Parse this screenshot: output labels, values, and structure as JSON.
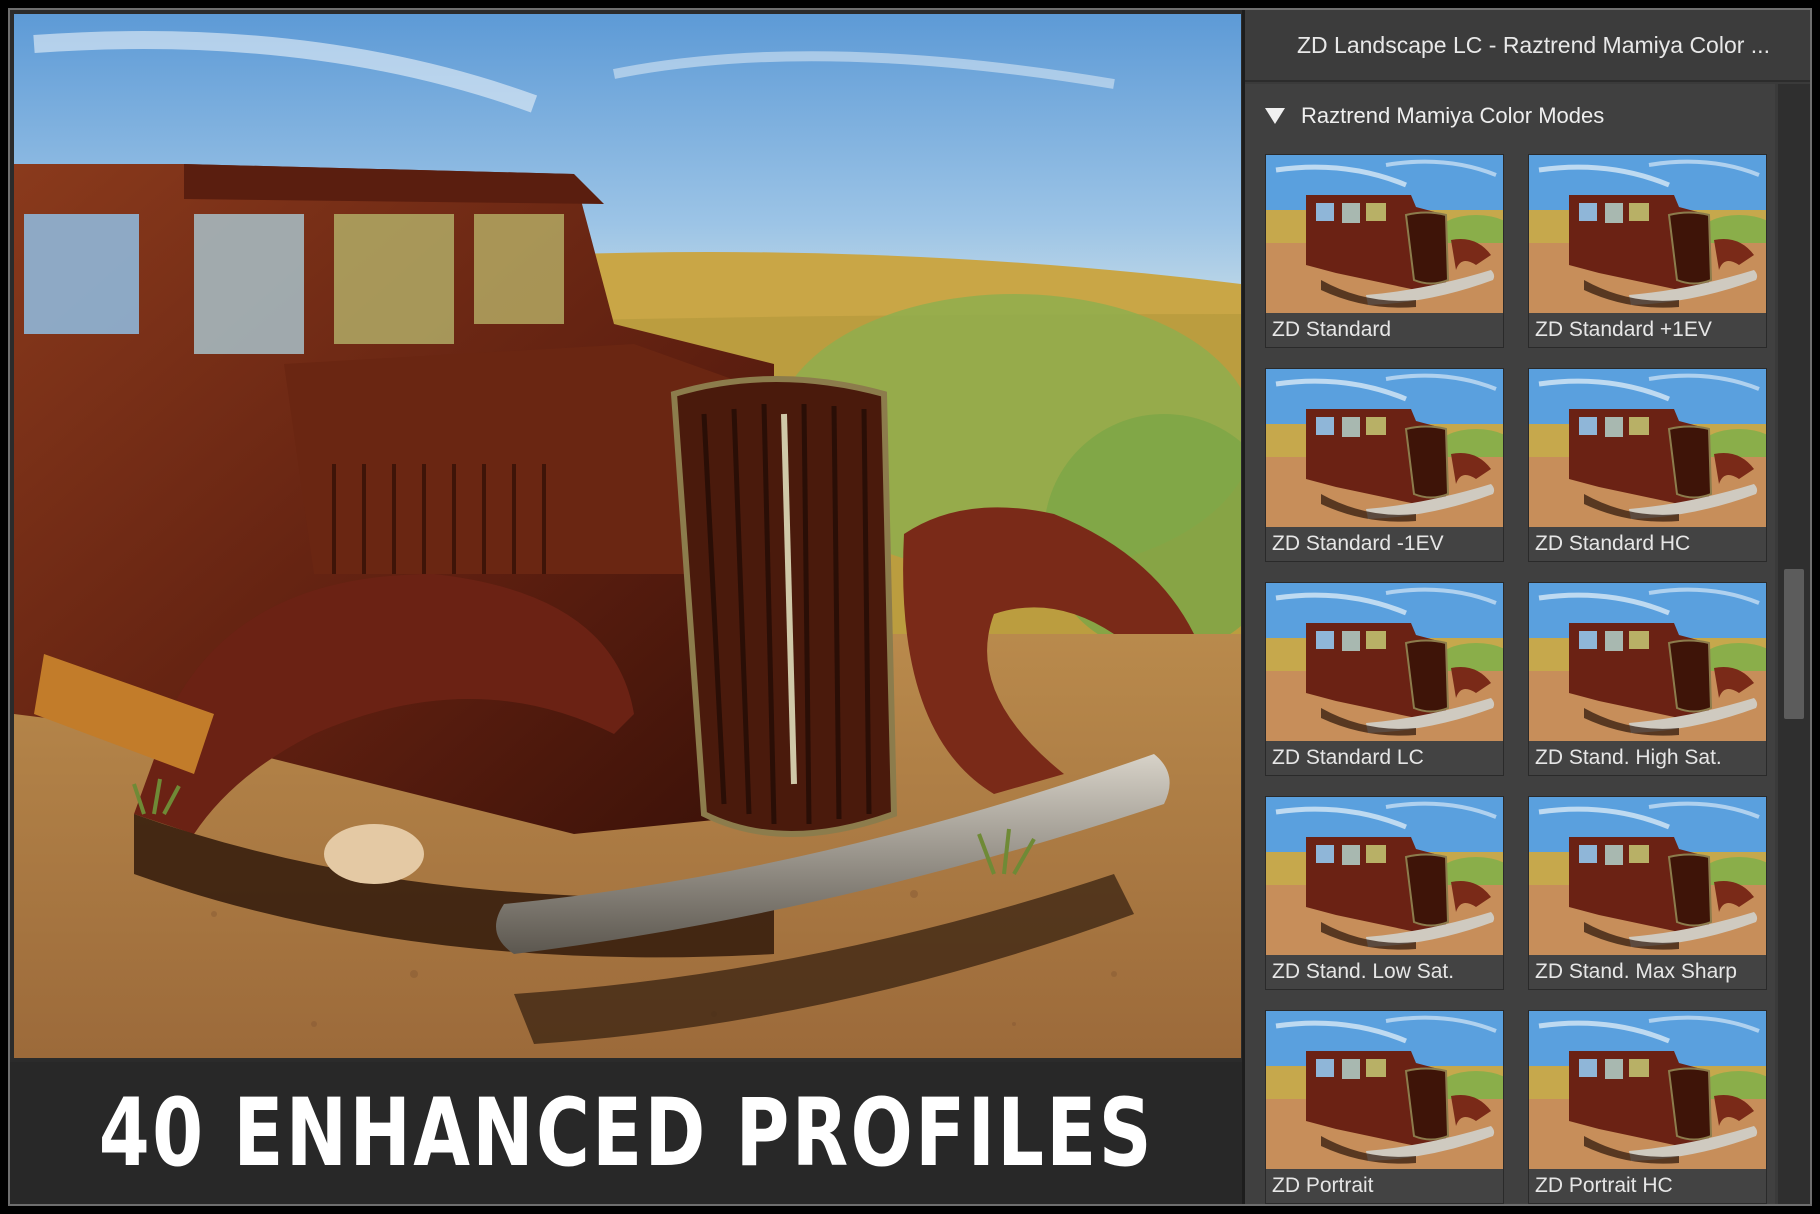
{
  "panel": {
    "title": "ZD Landscape LC - Raztrend Mamiya Color ...",
    "group_title": "Raztrend Mamiya Color Modes",
    "profiles": [
      {
        "label": "ZD Standard"
      },
      {
        "label": "ZD Standard +1EV"
      },
      {
        "label": "ZD Standard -1EV"
      },
      {
        "label": "ZD Standard HC"
      },
      {
        "label": "ZD Standard LC"
      },
      {
        "label": "ZD Stand. High Sat."
      },
      {
        "label": "ZD Stand. Low Sat."
      },
      {
        "label": "ZD Stand. Max Sharp"
      },
      {
        "label": "ZD Portrait"
      },
      {
        "label": "ZD Portrait HC"
      }
    ],
    "scroll_position": 0.5
  },
  "banner": {
    "text": "40 ENHANCED PROFILES"
  },
  "preview": {
    "image": "rusted-vintage-truck-in-desert"
  },
  "colors": {
    "panel_bg": "#404040",
    "header_bg": "#3c3c3c",
    "banner_bg": "#282828",
    "sky": "#6ea6d8",
    "rust": "#6b2414"
  }
}
